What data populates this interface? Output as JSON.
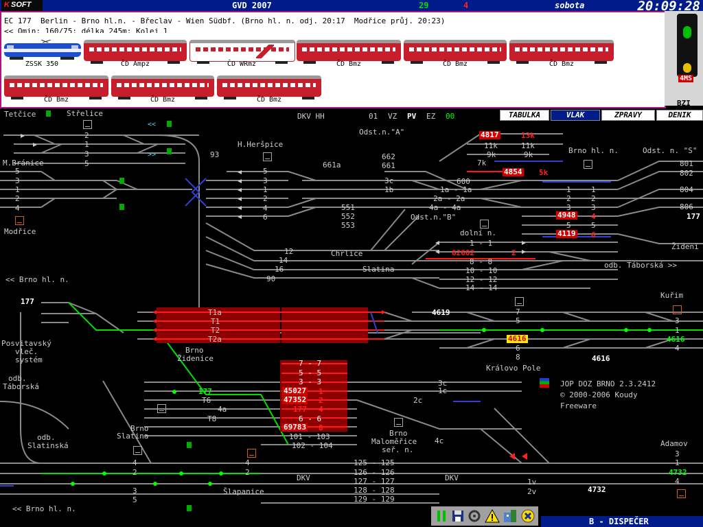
{
  "title_bar": {
    "logo_k": "K",
    "logo_soft": "SOFT",
    "gvd": "GVD 2007",
    "count_green": "29",
    "count_red": "4",
    "day": "sobota",
    "clock": "20:09:28"
  },
  "train": {
    "description": "EC 177  Berlin - Brno hl.n. - Břeclav - Wien Südbf. (Brno hl. n. odj. 20:17  Modřice průj. 20:23)",
    "subline": "<< Omin; 160/75; délka 245m; Kolej 1",
    "cars": [
      {
        "label": "ZSSK 350"
      },
      {
        "label": "ČD Ampz"
      },
      {
        "label": "ČD WRmz"
      },
      {
        "label": "ČD Bmz"
      },
      {
        "label": "ČD Bmz"
      },
      {
        "label": "ČD Bmz"
      },
      {
        "label": "ČD Bmz"
      },
      {
        "label": "ČD Bmz"
      },
      {
        "label": "ČD Bmz"
      }
    ]
  },
  "side_panel": {
    "speed": "4MS",
    "label": "BZI"
  },
  "menu": {
    "tabulka": "TABULKA",
    "vlak": "VLAK",
    "zpravy": "ZPRAVY",
    "denik": "DENIK"
  },
  "status_row": {
    "dkv": "DKV HH",
    "n01": "01",
    "vz": "VZ",
    "pv": "PV",
    "ez": "EZ",
    "n00": "00"
  },
  "stations": {
    "tetcice": "Tetčice",
    "strelice": "Střelice",
    "m_branice": "M.Bránice",
    "modrice": "Modřice",
    "h_herspice": "H.Heršpice",
    "odst_a": "Odst.n.\"A\"",
    "odst_b": "Odst.n.\"B\"",
    "brno_hl_n": "Brno hl. n.",
    "odst_s": "Odst. n. \"S\"",
    "dolni_n": "dolní n.",
    "chrlice": "Chrlice",
    "slatina": "Slatina",
    "zideni_r": "Židení",
    "odb_taborska_r": "odb. Táborská >>",
    "brno_hl_n_l": "<< Brno hl. n.",
    "posvitavsky": "Posvitavský",
    "posvitavsky2": "vleč.",
    "posvitavsky3": "systém",
    "brno_zidenice": "Brno",
    "brno_zidenice2": "Židenice",
    "odb_taborska_l": "odb.",
    "odb_taborska_l2": "Táborská",
    "odb_slatinska": "odb.",
    "odb_slatinska2": "Slatinská",
    "brno_slatina": "Brno",
    "brno_slatina2": "Slatina",
    "kralovo_pole": "Královo Pole",
    "kurim": "Kuřim",
    "slapanice": "Šlapanice",
    "brno_malomerice": "Brno",
    "brno_malomerice2": "Maloměřice",
    "brno_malomerice3": "seř. n.",
    "adamov": "Adamov",
    "brno_hl_n_bottom": "<< Brno hl. n.",
    "dkv": "DKV",
    "dkv2": "DKV"
  },
  "track_numbers": {
    "strelice": [
      "2",
      "1",
      "3",
      "5"
    ],
    "branice": [
      "5",
      "3",
      "1",
      "2",
      "4"
    ],
    "hersp": [
      "5",
      "3",
      "1",
      "2",
      "4",
      "6"
    ],
    "n93": "93",
    "n661a": "661a",
    "n662": "662",
    "n661": "661",
    "n3c": "3c",
    "n1b": "1b",
    "n600": "600",
    "n1a": "1a - 1a",
    "n2a": "2a - 2a",
    "n4a": "4a - 4a",
    "n551": "551",
    "n552": "552",
    "n553": "553",
    "n11k": "11k",
    "n11k2": "11k",
    "n9k": "9k",
    "n9k2": "9k",
    "n7k": "7k",
    "n13k": "13k",
    "n5k": "5k",
    "n12": "12",
    "n14": "14",
    "n16": "16",
    "n90": "90",
    "hl_n_left": [
      "1",
      "2",
      "3",
      "5"
    ],
    "hl_n_right": [
      "1",
      "2",
      "3",
      "4",
      "5",
      "6"
    ],
    "s_tracks": [
      "801",
      "802",
      "804",
      "806"
    ],
    "dolni": [
      "1 - 1",
      "2",
      "8 - 8",
      "10 - 10",
      "12 - 12",
      "14 - 14"
    ],
    "zid_tracks": [
      "T1a",
      "T1",
      "T2",
      "T2a"
    ],
    "maloa": [
      "7 - 7",
      "5 - 5",
      "3 - 3",
      "1",
      "2",
      "4",
      "6 - 6",
      "8"
    ],
    "n101": "101 - 103",
    "n102": "102 - 104",
    "n177": "177",
    "t6": "T6",
    "n4a_l": "4a",
    "t8": "T8",
    "n3c_b": "3c",
    "n1c": "1c",
    "n2c": "2c",
    "n4c": "4c",
    "kp": [
      "7",
      "5",
      "6",
      "8"
    ],
    "kurim": [
      "3",
      "1",
      "4"
    ],
    "adamov": [
      "3",
      "1",
      "4"
    ],
    "slatina": [
      "4",
      "2",
      "3",
      "5"
    ],
    "slap": [
      "4",
      "2"
    ],
    "mal_b": [
      "125 - 125",
      "126 - 126",
      "127 - 127",
      "128 - 128",
      "129 - 129"
    ],
    "n1v": "1v",
    "n2v": "2v"
  },
  "trains": {
    "t4817": "4817",
    "t4854": "4854",
    "t4948": "4948",
    "t4948s": "4",
    "t4119": "4119",
    "t4119s": "6",
    "t62602": "62602",
    "t177_top": "177",
    "t177_left": "177",
    "t4619": "4619",
    "t4616": "4616",
    "t4616b": "4616",
    "t4616c": "4616",
    "t45027": "45027",
    "t47352": "47352",
    "t177m": "177",
    "t69783": "69783",
    "t4732": "4732",
    "t4732b": "4732"
  },
  "about": {
    "line1": "JOP DOZ BRNO 2.3.2412",
    "line2": "© 2000-2006 Koudy",
    "line3": "Freeware"
  },
  "statusbar": {
    "text": "B - DISPEČER"
  },
  "toolbar_icons": [
    "pause-icon",
    "save-icon",
    "settings-icon",
    "warning-icon",
    "map-icon",
    "close-icon"
  ],
  "colors": {
    "title_bar": "#001c8a",
    "occupied": "#d40000",
    "route": "#00ff00",
    "track": "#8a8a8a",
    "panel_border": "#b0108c"
  }
}
